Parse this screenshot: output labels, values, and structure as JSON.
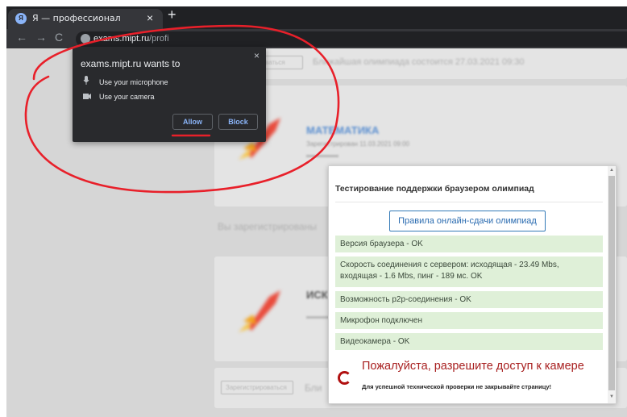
{
  "browser": {
    "tab_title": "Я — профессионал",
    "tab_favicon": "Я",
    "tab_close": "×",
    "new_tab": "+",
    "back": "←",
    "forward": "→",
    "reload": "C",
    "url_host": "exams.mipt.ru",
    "url_path": "/profi"
  },
  "page": {
    "register_button": "Зарегистрироваться",
    "next_olympiad": "Ближайшая олимпиада состоится 27.03.2021 09:30",
    "subject_1": "МАТЕМАТИКА",
    "subject_1_meta": "Зарегистрирован   11.03.2021 09:00",
    "registered_text": "Вы зарегистрированы",
    "subject_2": "ИСК",
    "register_button_2": "Зарегистрироваться",
    "bottom_text": "Бли"
  },
  "permission": {
    "title": "exams.mipt.ru wants to",
    "close": "×",
    "microphone": "Use your microphone",
    "camera": "Use your camera",
    "allow": "Allow",
    "block": "Block"
  },
  "annotation_color": "#e8202a",
  "dialog": {
    "title": "Тестирование поддержки браузером олимпиад",
    "rules_button": "Правила онлайн-сдачи олимпиад",
    "checks": [
      "Версия браузера - OK",
      "Скорость соединения с сервером: исходящая - 23.49 Mbs, входящая - 1.6 Mbs, пинг - 189 мс. OK",
      "Возможность p2p-соединения - OK",
      "Микрофон подключен",
      "Видеокамера - OK"
    ],
    "warning": "Пожалуйста, разрешите доступ к камере",
    "note": "Для успешной технической проверки не закрывайте страницу!",
    "colors": {
      "ok_bg": "#dff0d8",
      "warning": "#a82020",
      "button": "#337ab7"
    }
  }
}
